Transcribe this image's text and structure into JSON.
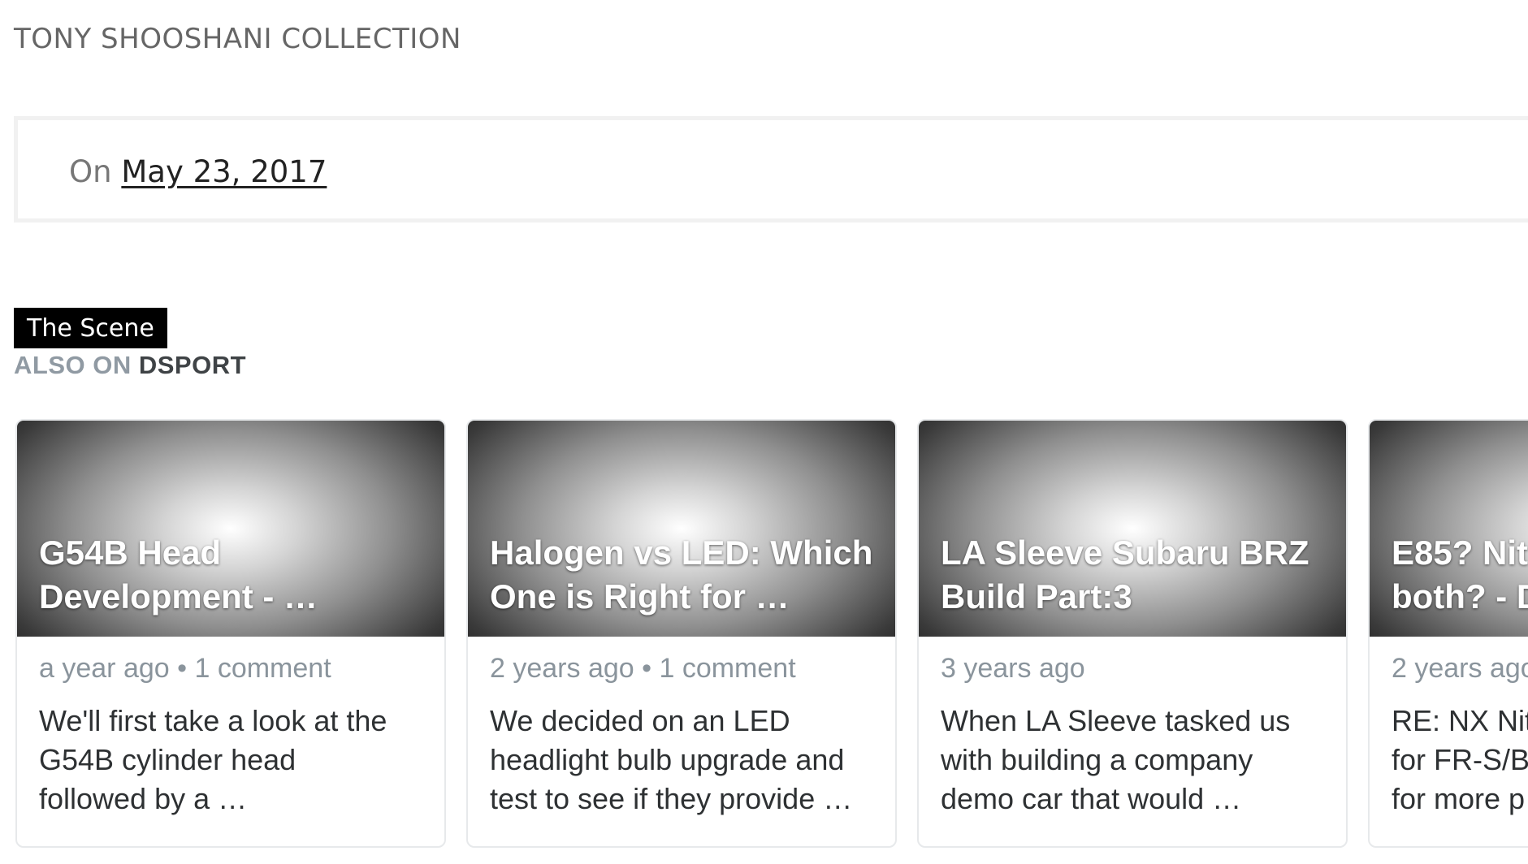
{
  "header": {
    "collection_title": "TONY SHOOSHANI COLLECTION"
  },
  "post_meta": {
    "prefix": "On",
    "date": "May 23, 2017"
  },
  "category_tag": "The Scene",
  "also_on": {
    "label": "ALSO ON",
    "brand": "DSPORT"
  },
  "cards": [
    {
      "title": "G54B Head\nDevelopment - …",
      "meta": "a year ago • 1 comment",
      "excerpt": "We'll first take a look at the\nG54B cylinder head\nfollowed by a …"
    },
    {
      "title": "Halogen vs LED: Which\nOne is Right for …",
      "meta": "2 years ago • 1 comment",
      "excerpt": "We decided on an LED\nheadlight bulb upgrade and\ntest to see if they provide …"
    },
    {
      "title": "LA Sleeve Subaru BRZ\nBuild Part:3",
      "meta": "3 years ago",
      "excerpt": "When LA Sleeve tasked us\nwith building a company\ndemo car that would …"
    },
    {
      "title": "E85? Nit\nboth? - D",
      "meta": "2 years ago",
      "excerpt": "RE: NX Nit\nfor FR-S/B\nfor more p"
    }
  ]
}
